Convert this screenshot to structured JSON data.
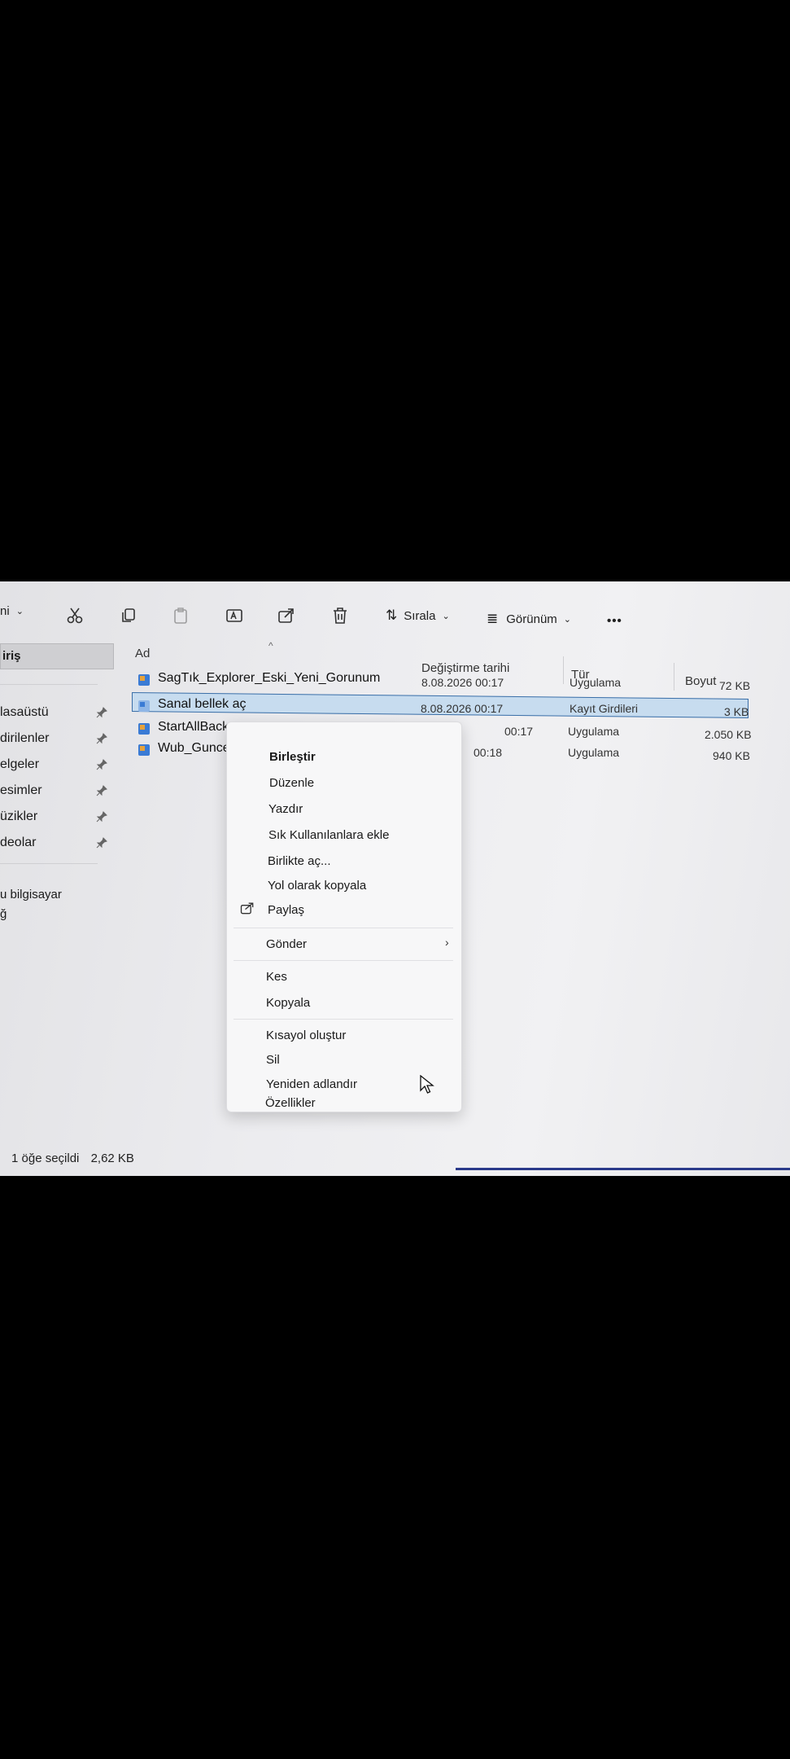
{
  "toolbar": {
    "new_label": "ni",
    "sort_label": "Sırala",
    "view_label": "Görünüm",
    "more_label": "•••",
    "icons": [
      "cut-icon",
      "copy-icon",
      "paste-icon",
      "rename-icon",
      "share-icon",
      "delete-icon"
    ]
  },
  "sidebar": {
    "home": "iriş",
    "items": [
      {
        "label": "lasaüstü",
        "pinned": true
      },
      {
        "label": "dirilenler",
        "pinned": true
      },
      {
        "label": "elgeler",
        "pinned": true
      },
      {
        "label": "esimler",
        "pinned": true
      },
      {
        "label": "üzikler",
        "pinned": true
      },
      {
        "label": "deolar",
        "pinned": true
      }
    ],
    "this_pc": "u bilgisayar",
    "network": "ğ"
  },
  "columns": {
    "name": "Ad",
    "date": "Değiştirme tarihi",
    "type": "Tür",
    "size": "Boyut"
  },
  "files": [
    {
      "name": "SagTık_Explorer_Eski_Yeni_Gorunum",
      "date": "8.08.2026 00:17",
      "type": "Uygulama",
      "size": "72 KB",
      "icon": "app-icon",
      "selected": false
    },
    {
      "name": "Sanal bellek aç",
      "date": "8.08.2026 00:17",
      "type": "Kayıt Girdileri",
      "size": "3 KB",
      "icon": "registry-icon",
      "selected": true
    },
    {
      "name": "StartAllBack",
      "date": "00:17",
      "type": "Uygulama",
      "size": "2.050 KB",
      "icon": "app-icon",
      "selected": false
    },
    {
      "name": "Wub_Gunce",
      "date": "00:18",
      "type": "Uygulama",
      "size": "940 KB",
      "icon": "app-icon",
      "selected": false
    }
  ],
  "context_menu": {
    "merge": "Birleştir",
    "edit": "Düzenle",
    "print": "Yazdır",
    "add_favorites": "Sık Kullanılanlara ekle",
    "open_with": "Birlikte aç...",
    "copy_path": "Yol olarak kopyala",
    "share": "Paylaş",
    "send_to": "Gönder",
    "cut": "Kes",
    "copy": "Kopyala",
    "create_shortcut": "Kısayol oluştur",
    "delete": "Sil",
    "rename": "Yeniden adlandır",
    "properties": "Özellikler"
  },
  "status": {
    "selection": "1 öğe seçildi",
    "size": "2,62 KB"
  },
  "colors": {
    "selection": "#c7dcef",
    "selection_border": "#3b6fa8",
    "accent": "#0067c0"
  }
}
